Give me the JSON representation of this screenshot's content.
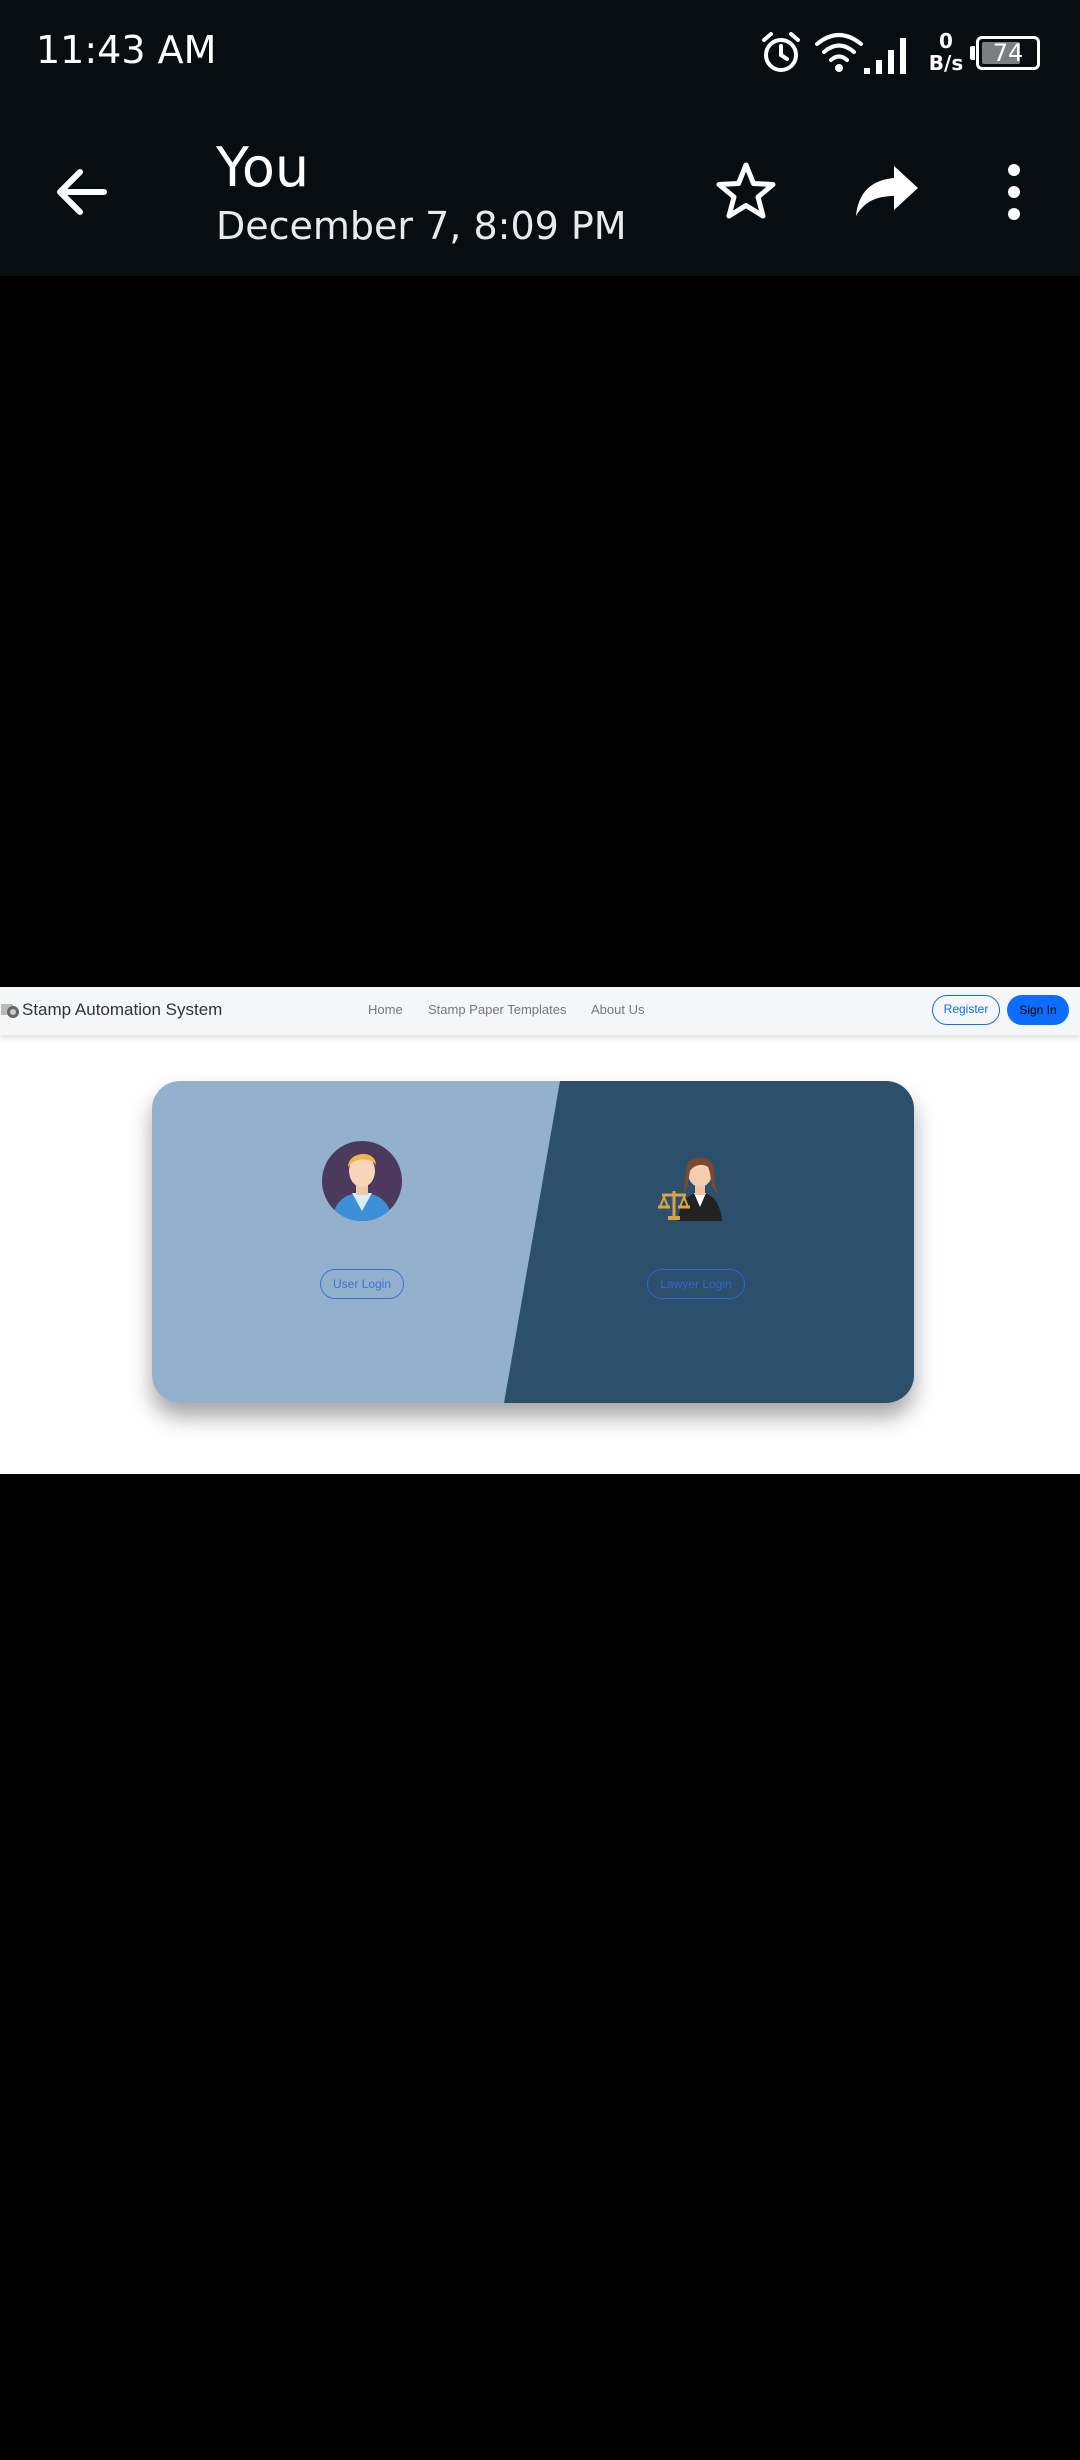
{
  "status_bar": {
    "time": "11:43 AM",
    "net_speed_value": "0",
    "net_speed_unit": "B/s",
    "battery": "74",
    "battery_level_percent": 74
  },
  "app_bar": {
    "title": "You",
    "subtitle": "December 7, 8:09 PM"
  },
  "web": {
    "brand": "Stamp Automation System",
    "nav": [
      "Home",
      "Stamp Paper Templates",
      "About Us"
    ],
    "register_label": "Register",
    "signin_label": "Sign In",
    "user_login_label": "User Login",
    "lawyer_login_label": "Lawyer Login"
  },
  "colors": {
    "status_bg": "#080d11",
    "card_left": "#93b1cc",
    "card_right": "#2c4f6c",
    "primary": "#0d6efd"
  }
}
